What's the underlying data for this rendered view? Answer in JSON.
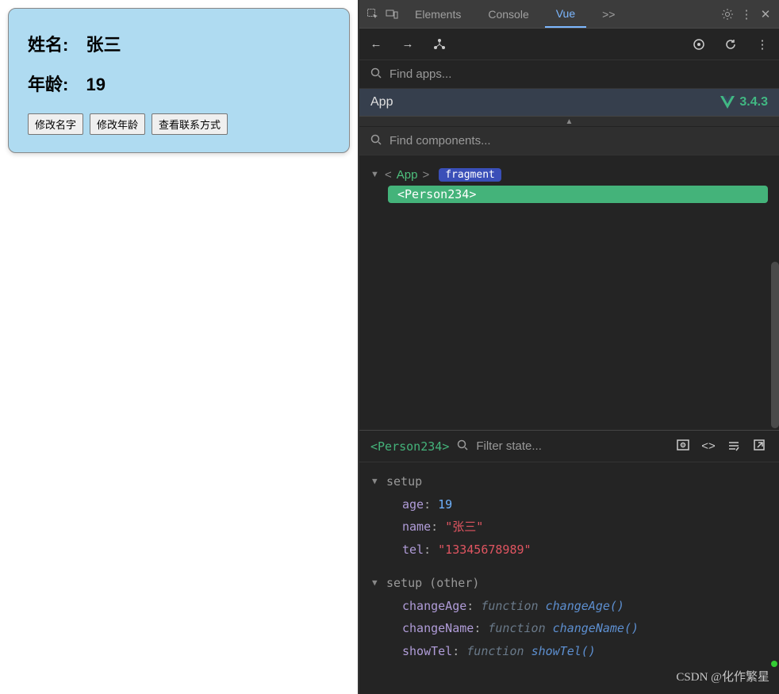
{
  "card": {
    "name_label": "姓名:",
    "name_value": "张三",
    "age_label": "年龄:",
    "age_value": "19",
    "buttons": {
      "change_name": "修改名字",
      "change_age": "修改年龄",
      "show_tel": "查看联系方式"
    }
  },
  "devtools": {
    "tabs": {
      "elements": "Elements",
      "console": "Console",
      "vue": "Vue",
      "more": ">>"
    },
    "find_apps_placeholder": "Find apps...",
    "app_label": "App",
    "vue_version": "3.4.3",
    "find_components_placeholder": "Find components...",
    "tree": {
      "root": "App",
      "root_badge": "fragment",
      "child": "Person234"
    },
    "state": {
      "selected_component": "Person234",
      "filter_placeholder": "Filter state...",
      "section_setup": "setup",
      "section_other": "setup (other)",
      "props": {
        "age_key": "age",
        "age_val": "19",
        "name_key": "name",
        "name_val": "\"张三\"",
        "tel_key": "tel",
        "tel_val": "\"13345678989\""
      },
      "fns": {
        "changeAge_key": "changeAge",
        "changeAge_sig": "changeAge()",
        "changeName_key": "changeName",
        "changeName_sig": "changeName()",
        "showTel_key": "showTel",
        "showTel_sig": "showTel()"
      },
      "fn_keyword": "function"
    }
  },
  "watermark": "CSDN @化作繁星"
}
